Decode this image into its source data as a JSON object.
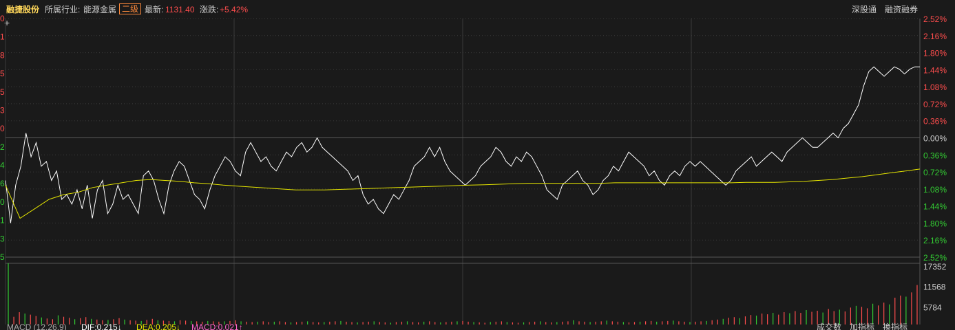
{
  "header": {
    "stock_name": "融捷股份",
    "industry_label": "所属行业:",
    "industry_value": "能源金属",
    "level_badge": "二级",
    "latest_label": "最新:",
    "latest_value": "1131.40",
    "change_label": "涨跌:",
    "change_value": "+5.42%",
    "right_links": [
      "深股通",
      "融资融券"
    ]
  },
  "colors": {
    "price_line": "#ffffff",
    "avg_line": "#e6e600",
    "up": "#ff4d4d",
    "down": "#33cc33",
    "grid": "#3a3a3a",
    "background": "#1a1a1a"
  },
  "icons": {
    "crosshair": "crosshair-icon"
  },
  "chart_data": [
    {
      "type": "line",
      "title": "",
      "ylabel_right_ticks": [
        "2.52%",
        "2.16%",
        "1.80%",
        "1.44%",
        "1.08%",
        "0.72%",
        "0.36%",
        "0.00%",
        "0.36%",
        "0.72%",
        "1.08%",
        "1.44%",
        "1.80%",
        "2.16%",
        "2.52%"
      ],
      "ylim_pct": [
        -2.52,
        2.52
      ],
      "left_ticks_partial": [
        "0",
        "1",
        "8",
        "5",
        "5",
        "3",
        "0",
        "2",
        "4",
        "6",
        "0",
        "1",
        "3",
        "5"
      ],
      "series": [
        {
          "role": "price",
          "values_pct": [
            -0.9,
            -1.8,
            -1.0,
            -0.6,
            0.1,
            -0.4,
            -0.1,
            -0.6,
            -0.5,
            -0.9,
            -0.7,
            -1.3,
            -1.2,
            -1.4,
            -1.1,
            -1.5,
            -1.0,
            -1.7,
            -1.1,
            -0.9,
            -1.6,
            -1.4,
            -1.0,
            -1.3,
            -1.2,
            -1.4,
            -1.6,
            -0.8,
            -0.7,
            -0.9,
            -1.3,
            -1.6,
            -1.0,
            -0.7,
            -0.5,
            -0.6,
            -0.9,
            -1.2,
            -1.3,
            -1.5,
            -1.1,
            -0.8,
            -0.6,
            -0.4,
            -0.5,
            -0.7,
            -0.8,
            -0.3,
            -0.1,
            -0.3,
            -0.5,
            -0.4,
            -0.6,
            -0.7,
            -0.5,
            -0.3,
            -0.4,
            -0.2,
            -0.1,
            -0.3,
            -0.2,
            0.0,
            -0.2,
            -0.3,
            -0.4,
            -0.5,
            -0.6,
            -0.7,
            -0.9,
            -0.8,
            -1.2,
            -1.4,
            -1.3,
            -1.5,
            -1.6,
            -1.4,
            -1.2,
            -1.3,
            -1.1,
            -0.9,
            -0.6,
            -0.5,
            -0.4,
            -0.2,
            -0.4,
            -0.2,
            -0.5,
            -0.7,
            -0.8,
            -0.9,
            -1.0,
            -0.9,
            -0.8,
            -0.6,
            -0.5,
            -0.4,
            -0.2,
            -0.3,
            -0.5,
            -0.6,
            -0.4,
            -0.5,
            -0.3,
            -0.4,
            -0.6,
            -0.8,
            -1.1,
            -1.2,
            -1.3,
            -1.0,
            -0.9,
            -0.8,
            -0.7,
            -0.9,
            -1.0,
            -1.2,
            -1.1,
            -0.9,
            -0.8,
            -0.6,
            -0.7,
            -0.5,
            -0.3,
            -0.4,
            -0.5,
            -0.6,
            -0.8,
            -0.7,
            -0.9,
            -1.0,
            -0.8,
            -0.7,
            -0.8,
            -0.6,
            -0.5,
            -0.6,
            -0.5,
            -0.6,
            -0.7,
            -0.8,
            -0.9,
            -1.0,
            -0.9,
            -0.7,
            -0.6,
            -0.5,
            -0.4,
            -0.6,
            -0.5,
            -0.4,
            -0.3,
            -0.4,
            -0.5,
            -0.3,
            -0.2,
            -0.1,
            0.0,
            -0.1,
            -0.2,
            -0.2,
            -0.1,
            0.0,
            0.1,
            0.0,
            0.2,
            0.3,
            0.5,
            0.7,
            1.1,
            1.4,
            1.5,
            1.4,
            1.3,
            1.4,
            1.5,
            1.45,
            1.35,
            1.45,
            1.5,
            1.5
          ]
        },
        {
          "role": "average",
          "values_pct": [
            -1.0,
            -1.7,
            -1.5,
            -1.3,
            -1.2,
            -1.15,
            -1.05,
            -1.0,
            -0.95,
            -0.9,
            -0.88,
            -0.9,
            -0.92,
            -0.95,
            -0.97,
            -1.0,
            -1.02,
            -1.04,
            -1.06,
            -1.08,
            -1.1,
            -1.1,
            -1.1,
            -1.09,
            -1.08,
            -1.07,
            -1.06,
            -1.05,
            -1.04,
            -1.03,
            -1.02,
            -1.01,
            -1.0,
            -0.99,
            -0.98,
            -0.97,
            -0.96,
            -0.96,
            -0.96,
            -0.96,
            -0.96,
            -0.96,
            -0.95,
            -0.95,
            -0.95,
            -0.95,
            -0.95,
            -0.95,
            -0.95,
            -0.95,
            -0.95,
            -0.94,
            -0.94,
            -0.94,
            -0.93,
            -0.92,
            -0.9,
            -0.88,
            -0.85,
            -0.82,
            -0.78,
            -0.74,
            -0.7,
            -0.66
          ]
        }
      ]
    },
    {
      "type": "bar",
      "title": "",
      "right_ticks": [
        "17352",
        "11568",
        "5784"
      ],
      "ylim": [
        0,
        17352
      ],
      "values": [
        17352,
        2200,
        3500,
        3100,
        2800,
        2400,
        2000,
        1700,
        1500,
        2600,
        2200,
        1900,
        1500,
        1800,
        2100,
        1600,
        1400,
        1200,
        1300,
        1500,
        1800,
        1400,
        1200,
        1100,
        1000,
        1300,
        1600,
        1200,
        1100,
        1000,
        900,
        1200,
        1100,
        1000,
        900,
        800,
        1000,
        900,
        800,
        900,
        1000,
        1200,
        900,
        800,
        700,
        800,
        900,
        700,
        800,
        900,
        700,
        600,
        700,
        800,
        900,
        700,
        600,
        700,
        800,
        900,
        1000,
        800,
        700,
        600,
        700,
        800,
        900,
        700,
        600,
        500,
        700,
        800,
        900,
        700,
        600,
        800,
        900,
        700,
        600,
        700,
        800,
        900,
        1000,
        800,
        700,
        600,
        500,
        700,
        800,
        900,
        700,
        600,
        500,
        600,
        700,
        800,
        900,
        700,
        600,
        700,
        800,
        900,
        1200,
        900,
        800,
        700,
        800,
        900,
        1100,
        900,
        800,
        700,
        600,
        700,
        800,
        900,
        1000,
        800,
        900,
        1000,
        1100,
        900,
        800,
        700,
        800,
        900,
        1000,
        1200,
        1400,
        1600,
        1900,
        2100,
        1800,
        2300,
        2700,
        2500,
        3100,
        2900,
        3300,
        2800,
        3500,
        3200,
        3800,
        3300,
        4100,
        3600,
        3900,
        3400,
        4400,
        3800,
        4200,
        3700,
        4800,
        5300,
        5000,
        4600,
        5900,
        5400,
        6200,
        5700,
        7600,
        8200,
        7900,
        9100,
        11200
      ],
      "up_flags_pattern": "alternate"
    }
  ],
  "footer": {
    "left_items": [
      "MACD (12,26,9)",
      "DIF:0.215↓",
      "DEA:0.205↓",
      "MACD:0.021↑"
    ],
    "right_items": [
      "成交数",
      "加指标",
      "换指标"
    ]
  }
}
